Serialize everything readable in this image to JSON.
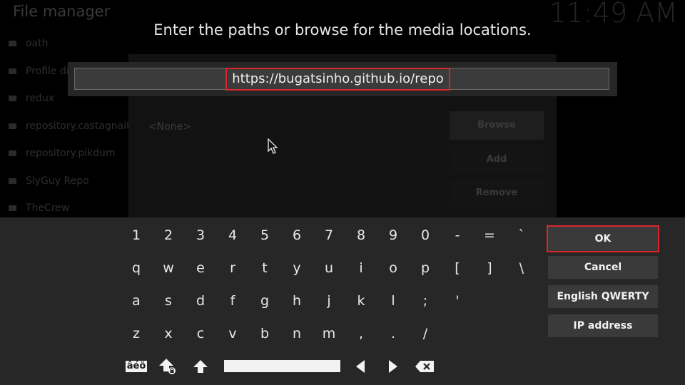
{
  "background": {
    "title": "File manager",
    "clock": "11:49 AM",
    "sources": [
      "oath",
      "Profile dir",
      "redux",
      "repository.castagnait",
      "repository.pikdum",
      "SlyGuy Repo",
      "TheCrew"
    ],
    "none_label": "<None>",
    "buttons": {
      "browse": "Browse",
      "add": "Add",
      "remove": "Remove"
    }
  },
  "dialog": {
    "heading": "Enter the paths or browse for the media locations.",
    "input_value": "https://bugatsinho.github.io/repo"
  },
  "keyboard": {
    "row1": [
      "1",
      "2",
      "3",
      "4",
      "5",
      "6",
      "7",
      "8",
      "9",
      "0",
      "-",
      "=",
      "`"
    ],
    "row2": [
      "q",
      "w",
      "e",
      "r",
      "t",
      "y",
      "u",
      "i",
      "o",
      "p",
      "[",
      "]",
      "\\"
    ],
    "row3": [
      "a",
      "s",
      "d",
      "f",
      "g",
      "h",
      "j",
      "k",
      "l",
      ";",
      "'"
    ],
    "row4": [
      "z",
      "x",
      "c",
      "v",
      "b",
      "n",
      "m",
      ",",
      ".",
      "/"
    ],
    "symbols_label": "âéö",
    "icons": [
      "caps-lock-icon",
      "shift-icon",
      "arrow-left-icon",
      "arrow-right-icon",
      "backspace-icon"
    ],
    "accent_color": "#d9262b"
  },
  "side": {
    "ok": "OK",
    "cancel": "Cancel",
    "layout": "English QWERTY",
    "ip": "IP address"
  }
}
